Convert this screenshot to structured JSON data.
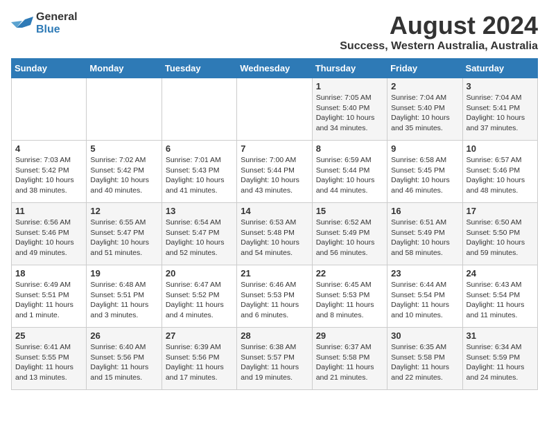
{
  "logo": {
    "line1": "General",
    "line2": "Blue"
  },
  "title": "August 2024",
  "subtitle": "Success, Western Australia, Australia",
  "days_of_week": [
    "Sunday",
    "Monday",
    "Tuesday",
    "Wednesday",
    "Thursday",
    "Friday",
    "Saturday"
  ],
  "weeks": [
    [
      {
        "day": "",
        "info": ""
      },
      {
        "day": "",
        "info": ""
      },
      {
        "day": "",
        "info": ""
      },
      {
        "day": "",
        "info": ""
      },
      {
        "day": "1",
        "info": "Sunrise: 7:05 AM\nSunset: 5:40 PM\nDaylight: 10 hours\nand 34 minutes."
      },
      {
        "day": "2",
        "info": "Sunrise: 7:04 AM\nSunset: 5:40 PM\nDaylight: 10 hours\nand 35 minutes."
      },
      {
        "day": "3",
        "info": "Sunrise: 7:04 AM\nSunset: 5:41 PM\nDaylight: 10 hours\nand 37 minutes."
      }
    ],
    [
      {
        "day": "4",
        "info": "Sunrise: 7:03 AM\nSunset: 5:42 PM\nDaylight: 10 hours\nand 38 minutes."
      },
      {
        "day": "5",
        "info": "Sunrise: 7:02 AM\nSunset: 5:42 PM\nDaylight: 10 hours\nand 40 minutes."
      },
      {
        "day": "6",
        "info": "Sunrise: 7:01 AM\nSunset: 5:43 PM\nDaylight: 10 hours\nand 41 minutes."
      },
      {
        "day": "7",
        "info": "Sunrise: 7:00 AM\nSunset: 5:44 PM\nDaylight: 10 hours\nand 43 minutes."
      },
      {
        "day": "8",
        "info": "Sunrise: 6:59 AM\nSunset: 5:44 PM\nDaylight: 10 hours\nand 44 minutes."
      },
      {
        "day": "9",
        "info": "Sunrise: 6:58 AM\nSunset: 5:45 PM\nDaylight: 10 hours\nand 46 minutes."
      },
      {
        "day": "10",
        "info": "Sunrise: 6:57 AM\nSunset: 5:46 PM\nDaylight: 10 hours\nand 48 minutes."
      }
    ],
    [
      {
        "day": "11",
        "info": "Sunrise: 6:56 AM\nSunset: 5:46 PM\nDaylight: 10 hours\nand 49 minutes."
      },
      {
        "day": "12",
        "info": "Sunrise: 6:55 AM\nSunset: 5:47 PM\nDaylight: 10 hours\nand 51 minutes."
      },
      {
        "day": "13",
        "info": "Sunrise: 6:54 AM\nSunset: 5:47 PM\nDaylight: 10 hours\nand 52 minutes."
      },
      {
        "day": "14",
        "info": "Sunrise: 6:53 AM\nSunset: 5:48 PM\nDaylight: 10 hours\nand 54 minutes."
      },
      {
        "day": "15",
        "info": "Sunrise: 6:52 AM\nSunset: 5:49 PM\nDaylight: 10 hours\nand 56 minutes."
      },
      {
        "day": "16",
        "info": "Sunrise: 6:51 AM\nSunset: 5:49 PM\nDaylight: 10 hours\nand 58 minutes."
      },
      {
        "day": "17",
        "info": "Sunrise: 6:50 AM\nSunset: 5:50 PM\nDaylight: 10 hours\nand 59 minutes."
      }
    ],
    [
      {
        "day": "18",
        "info": "Sunrise: 6:49 AM\nSunset: 5:51 PM\nDaylight: 11 hours\nand 1 minute."
      },
      {
        "day": "19",
        "info": "Sunrise: 6:48 AM\nSunset: 5:51 PM\nDaylight: 11 hours\nand 3 minutes."
      },
      {
        "day": "20",
        "info": "Sunrise: 6:47 AM\nSunset: 5:52 PM\nDaylight: 11 hours\nand 4 minutes."
      },
      {
        "day": "21",
        "info": "Sunrise: 6:46 AM\nSunset: 5:53 PM\nDaylight: 11 hours\nand 6 minutes."
      },
      {
        "day": "22",
        "info": "Sunrise: 6:45 AM\nSunset: 5:53 PM\nDaylight: 11 hours\nand 8 minutes."
      },
      {
        "day": "23",
        "info": "Sunrise: 6:44 AM\nSunset: 5:54 PM\nDaylight: 11 hours\nand 10 minutes."
      },
      {
        "day": "24",
        "info": "Sunrise: 6:43 AM\nSunset: 5:54 PM\nDaylight: 11 hours\nand 11 minutes."
      }
    ],
    [
      {
        "day": "25",
        "info": "Sunrise: 6:41 AM\nSunset: 5:55 PM\nDaylight: 11 hours\nand 13 minutes."
      },
      {
        "day": "26",
        "info": "Sunrise: 6:40 AM\nSunset: 5:56 PM\nDaylight: 11 hours\nand 15 minutes."
      },
      {
        "day": "27",
        "info": "Sunrise: 6:39 AM\nSunset: 5:56 PM\nDaylight: 11 hours\nand 17 minutes."
      },
      {
        "day": "28",
        "info": "Sunrise: 6:38 AM\nSunset: 5:57 PM\nDaylight: 11 hours\nand 19 minutes."
      },
      {
        "day": "29",
        "info": "Sunrise: 6:37 AM\nSunset: 5:58 PM\nDaylight: 11 hours\nand 21 minutes."
      },
      {
        "day": "30",
        "info": "Sunrise: 6:35 AM\nSunset: 5:58 PM\nDaylight: 11 hours\nand 22 minutes."
      },
      {
        "day": "31",
        "info": "Sunrise: 6:34 AM\nSunset: 5:59 PM\nDaylight: 11 hours\nand 24 minutes."
      }
    ]
  ]
}
